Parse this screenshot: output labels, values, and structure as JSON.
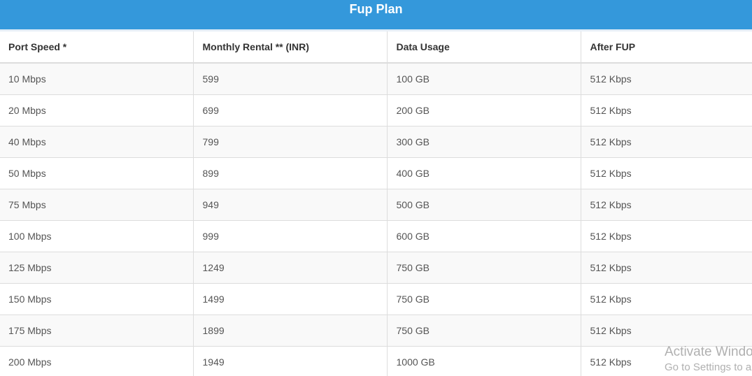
{
  "header": {
    "title": "Fup Plan"
  },
  "table": {
    "columns": [
      "Port Speed *",
      "Monthly Rental ** (INR)",
      "Data Usage",
      "After FUP"
    ],
    "rows": [
      [
        "10 Mbps",
        "599",
        "100 GB",
        "512 Kbps"
      ],
      [
        "20 Mbps",
        "699",
        "200 GB",
        "512 Kbps"
      ],
      [
        "40 Mbps",
        "799",
        "300 GB",
        "512 Kbps"
      ],
      [
        "50 Mbps",
        "899",
        "400 GB",
        "512 Kbps"
      ],
      [
        "75 Mbps",
        "949",
        "500 GB",
        "512 Kbps"
      ],
      [
        "100 Mbps",
        "999",
        "600 GB",
        "512 Kbps"
      ],
      [
        "125 Mbps",
        "1249",
        "750 GB",
        "512 Kbps"
      ],
      [
        "150 Mbps",
        "1499",
        "750 GB",
        "512 Kbps"
      ],
      [
        "175 Mbps",
        "1899",
        "750 GB",
        "512 Kbps"
      ],
      [
        "200 Mbps",
        "1949",
        "1000 GB",
        "512 Kbps"
      ]
    ]
  },
  "watermark": {
    "line1": "Activate Windo",
    "line2": "Go to Settings to a"
  },
  "colors": {
    "header_bg": "#3498db",
    "stripe": "#f9f9f9",
    "border": "#dddddd"
  }
}
